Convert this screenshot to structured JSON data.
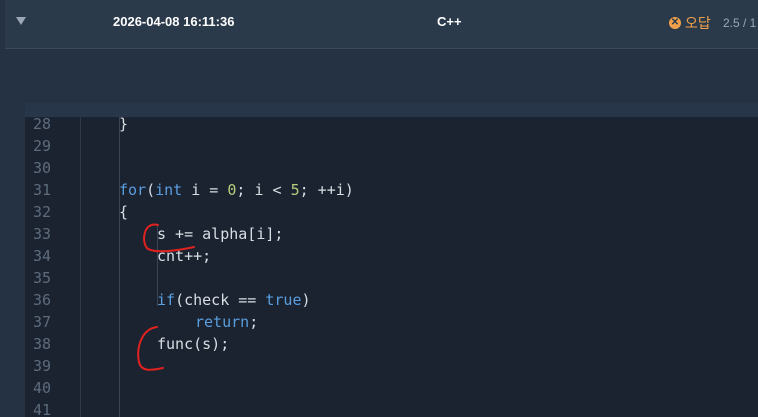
{
  "header": {
    "date": "2026-04-08 16:11:36",
    "language": "C++",
    "status_label": "오답",
    "status_icon": "x-circle-icon",
    "score": "2.5 / 1",
    "accent_color": "#f0a04b"
  },
  "code": {
    "lines": [
      {
        "n": "28",
        "text": "}"
      },
      {
        "n": "29",
        "text": ""
      },
      {
        "n": "30",
        "text": ""
      },
      {
        "n": "31",
        "text": "for(int i = 0; i < 5; ++i)"
      },
      {
        "n": "32",
        "text": "{"
      },
      {
        "n": "33",
        "text": "s += alpha[i];"
      },
      {
        "n": "34",
        "text": "cnt++;"
      },
      {
        "n": "35",
        "text": ""
      },
      {
        "n": "36",
        "text": "if(check == true)"
      },
      {
        "n": "37",
        "text": "return;"
      },
      {
        "n": "38",
        "text": "func(s);"
      },
      {
        "n": "39",
        "text": ""
      },
      {
        "n": "40",
        "text": ""
      },
      {
        "n": "41",
        "text": ""
      }
    ]
  }
}
